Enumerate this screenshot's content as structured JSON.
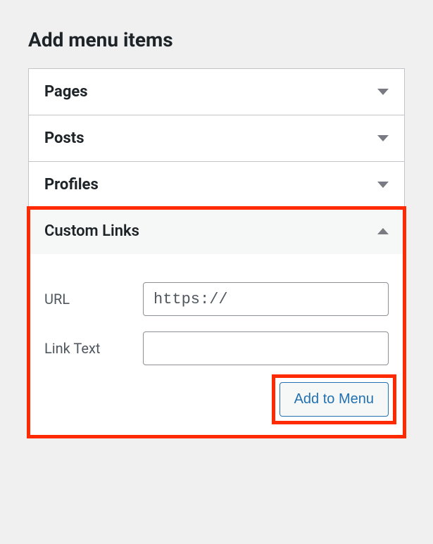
{
  "section": {
    "title": "Add menu items"
  },
  "accordion": {
    "pages": {
      "label": "Pages"
    },
    "posts": {
      "label": "Posts"
    },
    "profiles": {
      "label": "Profiles"
    },
    "customLinks": {
      "label": "Custom Links",
      "urlLabel": "URL",
      "urlValue": "https://",
      "linkTextLabel": "Link Text",
      "linkTextValue": "",
      "addButton": "Add to Menu"
    }
  }
}
